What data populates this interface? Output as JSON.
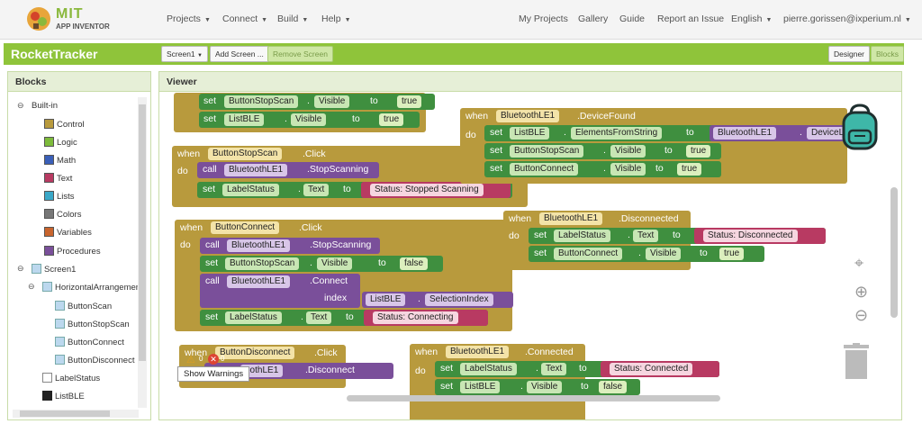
{
  "brand": {
    "line1": "MIT",
    "line2": "APP INVENTOR"
  },
  "topnav": {
    "projects": "Projects",
    "connect": "Connect",
    "build": "Build",
    "help": "Help"
  },
  "rightnav": {
    "my_projects": "My Projects",
    "gallery": "Gallery",
    "guide": "Guide",
    "report": "Report an Issue",
    "language": "English",
    "user": "pierre.gorissen@ixperium.nl"
  },
  "toolbar": {
    "project": "RocketTracker",
    "screen": "Screen1",
    "add_screen": "Add Screen ...",
    "remove_screen": "Remove Screen",
    "designer": "Designer",
    "blocks": "Blocks"
  },
  "blocks_panel": {
    "title": "Blocks",
    "builtin": "Built-in",
    "builtin_items": [
      "Control",
      "Logic",
      "Math",
      "Text",
      "Lists",
      "Colors",
      "Variables",
      "Procedures"
    ],
    "screen": "Screen1",
    "arrangement": "HorizontalArrangement",
    "components": [
      "ButtonScan",
      "ButtonStopScan",
      "ButtonConnect",
      "ButtonDisconnect"
    ],
    "label": "LabelStatus",
    "list": "ListBLE"
  },
  "viewer": {
    "title": "Viewer",
    "show_warnings": "Show Warnings",
    "warn_count": "0",
    "err_count": "0"
  },
  "colors": {
    "control": "#b89a3d",
    "logic": "#7dbb3b",
    "math": "#3a5fb8",
    "text": "#b83a62",
    "lists": "#3aa8c8",
    "colors": "#777777",
    "variables": "#c8642d",
    "procedures": "#7a4f9a",
    "accent": "#8fc43a"
  },
  "code": {
    "b1": {
      "set": "set",
      "comp1": "ButtonStopScan",
      "prop": "Visible",
      "to": "to",
      "val1": "true",
      "comp2": "ListBLE",
      "val2": "true"
    },
    "b2": {
      "when": "when",
      "comp": "ButtonStopScan",
      "event": ".Click",
      "do": "do",
      "call": "call",
      "ble": "BluetoothLE1",
      "method": ".StopScanning",
      "set": "set",
      "label": "LabelStatus",
      "text": "Text",
      "to": "to",
      "str": "Status: Stopped Scanning"
    },
    "b3": {
      "when": "when",
      "ble": "BluetoothLE1",
      "event": ".DeviceFound",
      "do": "do",
      "set": "set",
      "list": "ListBLE",
      "elements": "ElementsFromString",
      "to": "to",
      "device": "DeviceL",
      "stop": "ButtonStopScan",
      "visible": "Visible",
      "val": "true",
      "connect": "ButtonConnect",
      "val2": "true"
    },
    "b4": {
      "when": "when",
      "comp": "ButtonConnect",
      "event": ".Click",
      "do": "do",
      "call": "call",
      "ble": "BluetoothLE1",
      "stop": ".StopScanning",
      "set": "set",
      "stopbtn": "ButtonStopScan",
      "visible": "Visible",
      "to": "to",
      "val": "false",
      "connect": ".Connect",
      "index": "index",
      "list": "ListBLE",
      "sel": "SelectionIndex",
      "label": "LabelStatus",
      "text": "Text",
      "str": "Status: Connecting"
    },
    "b5": {
      "when": "when",
      "ble": "BluetoothLE1",
      "event": ".Disconnected",
      "do": "do",
      "set": "set",
      "label": "LabelStatus",
      "text": "Text",
      "to": "to",
      "str": "Status: Disconnected",
      "btn": "ButtonConnect",
      "visible": "Visible",
      "val": "true"
    },
    "b6": {
      "when": "when",
      "comp": "ButtonDisconnect",
      "event": ".Click",
      "ble": "oothLE1",
      "method": ".Disconnect"
    },
    "b7": {
      "when": "when",
      "ble": "BluetoothLE1",
      "event": ".Connected",
      "do": "do",
      "set": "set",
      "label": "LabelStatus",
      "text": "Text",
      "to": "to",
      "str": "Status: Connected",
      "list": "ListBLE",
      "visible": "Visible",
      "val": "false"
    }
  }
}
